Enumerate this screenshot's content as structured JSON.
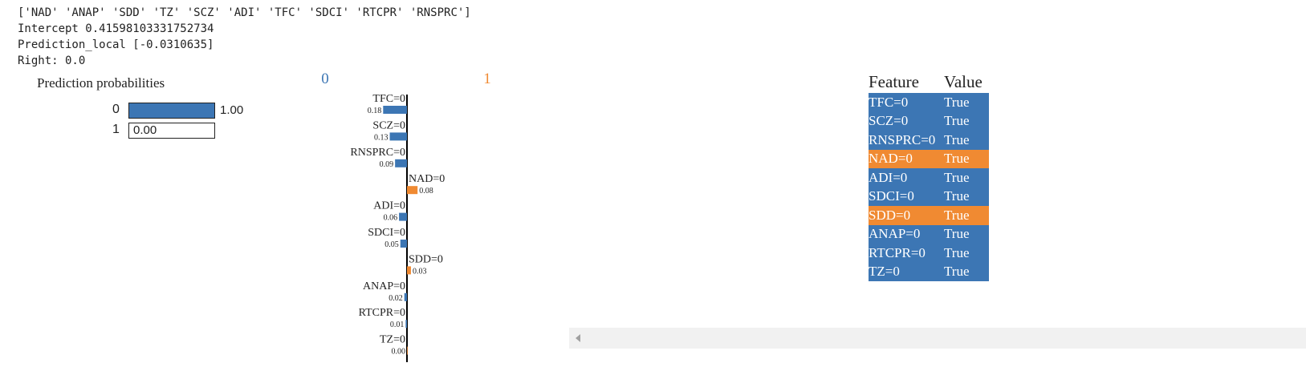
{
  "console": {
    "line1": "['NAD' 'ANAP' 'SDD' 'TZ' 'SCZ' 'ADI' 'TFC' 'SDCI' 'RTCPR' 'RNSPRC']",
    "line2": "Intercept 0.41598103331752734",
    "line3": "Prediction_local [-0.0310635]",
    "line4": "Right: 0.0"
  },
  "colors": {
    "class0": "#3c76b4",
    "class1": "#f08a32",
    "text": "#222222"
  },
  "chart_data": [
    {
      "type": "bar",
      "title": "Prediction probabilities",
      "categories": [
        "0",
        "1"
      ],
      "values": [
        1.0,
        0.0
      ],
      "value_labels": [
        "1.00",
        "0.00"
      ],
      "xlim": [
        0,
        1
      ]
    },
    {
      "type": "bar",
      "orientation": "horizontal",
      "class_labels": {
        "left": "0",
        "right": "1"
      },
      "categories": [
        "TFC=0",
        "SCZ=0",
        "RNSPRC=0",
        "NAD=0",
        "ADI=0",
        "SDCI=0",
        "SDD=0",
        "ANAP=0",
        "RTCPR=0",
        "TZ=0"
      ],
      "values": [
        -0.18,
        -0.13,
        -0.09,
        0.08,
        -0.06,
        -0.05,
        0.03,
        -0.02,
        -0.01,
        0.0
      ],
      "value_labels": [
        "0.18",
        "0.13",
        "0.09",
        "0.08",
        "0.06",
        "0.05",
        "0.03",
        "0.02",
        "0.01",
        "0.00"
      ]
    },
    {
      "type": "table",
      "columns": [
        "Feature",
        "Value"
      ],
      "rows": [
        {
          "feature": "TFC=0",
          "value": "True",
          "class": "0"
        },
        {
          "feature": "SCZ=0",
          "value": "True",
          "class": "0"
        },
        {
          "feature": "RNSPRC=0",
          "value": "True",
          "class": "0"
        },
        {
          "feature": "NAD=0",
          "value": "True",
          "class": "1"
        },
        {
          "feature": "ADI=0",
          "value": "True",
          "class": "0"
        },
        {
          "feature": "SDCI=0",
          "value": "True",
          "class": "0"
        },
        {
          "feature": "SDD=0",
          "value": "True",
          "class": "1"
        },
        {
          "feature": "ANAP=0",
          "value": "True",
          "class": "0"
        },
        {
          "feature": "RTCPR=0",
          "value": "True",
          "class": "0"
        },
        {
          "feature": "TZ=0",
          "value": "True",
          "class": "0"
        }
      ]
    }
  ]
}
